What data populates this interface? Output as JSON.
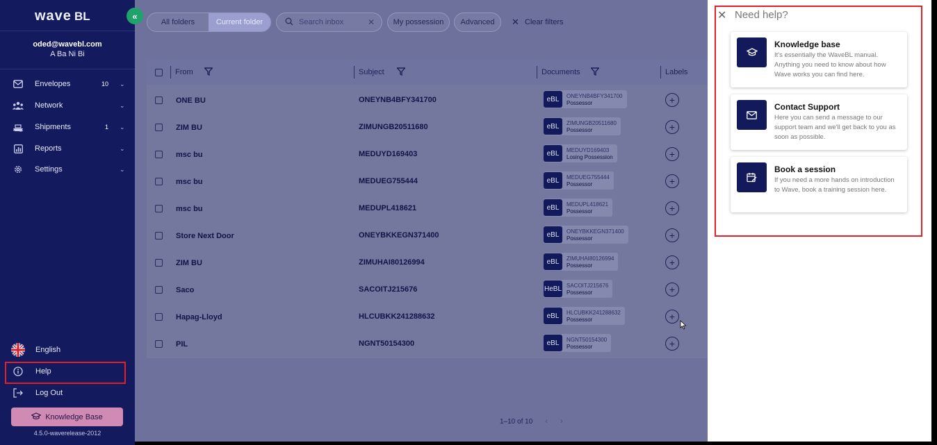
{
  "sidebar": {
    "logo_main": "wave",
    "logo_sub": "BL",
    "toggle_glyph": "«",
    "user_email": "oded@wavebl.com",
    "user_name": "A Ba Ni Bi",
    "nav": [
      {
        "label": "Envelopes",
        "badge": "10",
        "icon": "envelope-icon"
      },
      {
        "label": "Network",
        "badge": "",
        "icon": "network-icon"
      },
      {
        "label": "Shipments",
        "badge": "1",
        "icon": "shipments-icon"
      },
      {
        "label": "Reports",
        "badge": "",
        "icon": "reports-icon"
      },
      {
        "label": "Settings",
        "badge": "",
        "icon": "gear-icon"
      }
    ],
    "language": "English",
    "help": "Help",
    "logout": "Log Out",
    "knowledge_base_button": "Knowledge Base",
    "version": "4.5.0-waverelease-2012"
  },
  "toolbar": {
    "all_folders": "All folders",
    "current_folder": "Current folder",
    "search_placeholder": "Search inbox",
    "my_possession": "My possession",
    "advanced": "Advanced",
    "clear_filters": "Clear filters"
  },
  "table": {
    "columns": {
      "from": "From",
      "subject": "Subject",
      "documents": "Documents",
      "labels": "Labels"
    },
    "rows": [
      {
        "from": "ONE BU",
        "subject": "ONEYNB4BFY341700",
        "doc_type": "eBL",
        "doc_ref": "ONEYNB4BFY341700",
        "doc_status": "Possessor"
      },
      {
        "from": "ZIM BU",
        "subject": "ZIMUNGB20511680",
        "doc_type": "eBL",
        "doc_ref": "ZIMUNGB20511680",
        "doc_status": "Possessor"
      },
      {
        "from": "msc bu",
        "subject": "MEDUYD169403",
        "doc_type": "eBL",
        "doc_ref": "MEDUYD169403",
        "doc_status": "Losing Possession"
      },
      {
        "from": "msc bu",
        "subject": "MEDUEG755444",
        "doc_type": "eBL",
        "doc_ref": "MEDUEG755444",
        "doc_status": "Possessor"
      },
      {
        "from": "msc bu",
        "subject": "MEDUPL418621",
        "doc_type": "eBL",
        "doc_ref": "MEDUPL418621",
        "doc_status": "Possessor"
      },
      {
        "from": "Store Next Door",
        "subject": "ONEYBKKEGN371400",
        "doc_type": "eBL",
        "doc_ref": "ONEYBKKEGN371400",
        "doc_status": "Possessor"
      },
      {
        "from": "ZIM BU",
        "subject": "ZIMUHAI80126994",
        "doc_type": "eBL",
        "doc_ref": "ZIMUHAI80126994",
        "doc_status": "Possessor"
      },
      {
        "from": "Saco",
        "subject": "SACOITJ215676",
        "doc_type": "HeBL",
        "doc_ref": "SACOITJ215676",
        "doc_status": "Possessor"
      },
      {
        "from": "Hapag-Lloyd",
        "subject": "HLCUBKK241288632",
        "doc_type": "eBL",
        "doc_ref": "HLCUBKK241288632",
        "doc_status": "Possessor"
      },
      {
        "from": "PIL",
        "subject": "NGNT50154300",
        "doc_type": "eBL",
        "doc_ref": "NGNT50154300",
        "doc_status": "Possessor"
      }
    ]
  },
  "pagination": {
    "range": "1–10 of 10"
  },
  "help_panel": {
    "title": "Need help?",
    "cards": [
      {
        "title": "Knowledge base",
        "description": "It's essentially the WaveBL manual. Anything you need to know about how Wave works you can find here.",
        "icon": "graduation-cap-icon"
      },
      {
        "title": "Contact Support",
        "description": "Here you can send a message to our support team and we'll get back to you as soon as possible.",
        "icon": "mail-icon"
      },
      {
        "title": "Book a session",
        "description": "If you need a more hands on introduction to Wave, book a training session here.",
        "icon": "calendar-edit-icon"
      }
    ]
  },
  "colors": {
    "sidebar_bg": "#141a5e",
    "accent_green": "#1fa36b",
    "kb_button": "#d18ab3",
    "highlight_red": "#e0202a"
  }
}
